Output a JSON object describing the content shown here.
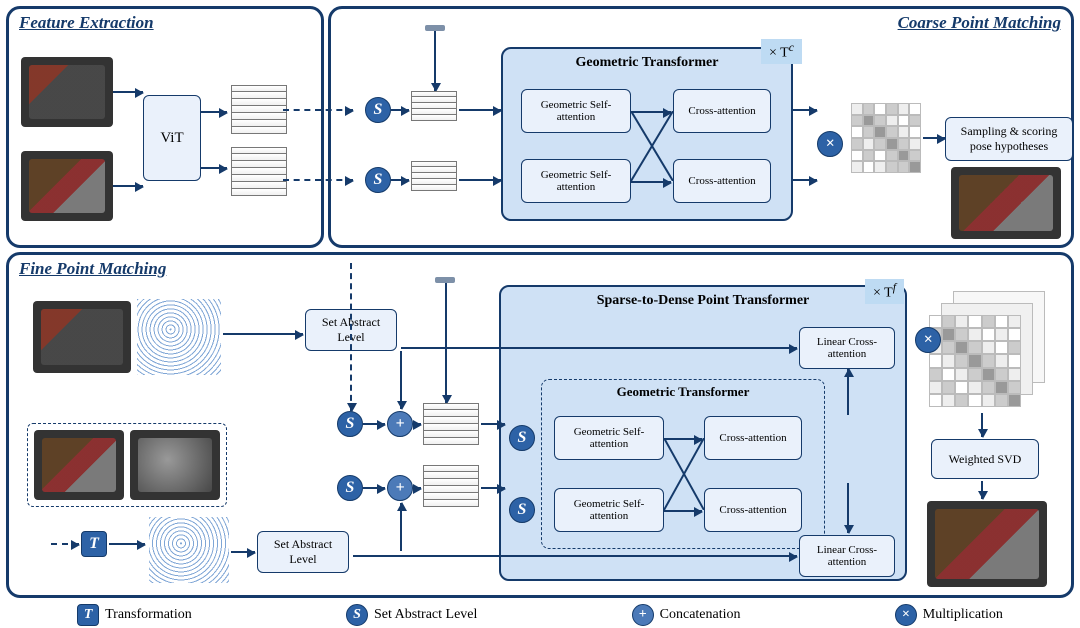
{
  "sections": {
    "feature_extraction": "Feature Extraction",
    "coarse": "Coarse Point Matching",
    "fine": "Fine Point Matching"
  },
  "modules": {
    "vit": "ViT",
    "geo_transformer_title": "Geometric Transformer",
    "geo_self_attn": "Geometric Self-attention",
    "cross_attn": "Cross-attention",
    "sampling": "Sampling & scoring pose hypotheses",
    "s2d_title": "Sparse-to-Dense Point Transformer",
    "linear_cross": "Linear Cross-attention",
    "set_abstract": "Set Abstract Level",
    "weighted_svd": "Weighted SVD"
  },
  "symbols": {
    "S": "S",
    "T": "T",
    "plus": "+",
    "times": "×",
    "repeat_coarse": "× T",
    "repeat_coarse_sup": "c",
    "repeat_fine": "× T",
    "repeat_fine_sup": "f"
  },
  "legend": {
    "T": "Transformation",
    "S": "Set Abstract Level",
    "plus": "Concatenation",
    "times": "Multiplication"
  }
}
